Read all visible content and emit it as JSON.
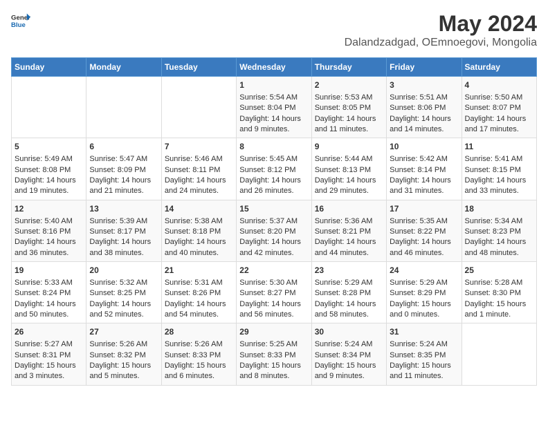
{
  "header": {
    "logo_line1": "General",
    "logo_line2": "Blue",
    "title": "May 2024",
    "subtitle": "Dalandzadgad, OEmnoegovi, Mongolia"
  },
  "weekdays": [
    "Sunday",
    "Monday",
    "Tuesday",
    "Wednesday",
    "Thursday",
    "Friday",
    "Saturday"
  ],
  "weeks": [
    [
      {
        "day": "",
        "content": ""
      },
      {
        "day": "",
        "content": ""
      },
      {
        "day": "",
        "content": ""
      },
      {
        "day": "1",
        "content": "Sunrise: 5:54 AM\nSunset: 8:04 PM\nDaylight: 14 hours\nand 9 minutes."
      },
      {
        "day": "2",
        "content": "Sunrise: 5:53 AM\nSunset: 8:05 PM\nDaylight: 14 hours\nand 11 minutes."
      },
      {
        "day": "3",
        "content": "Sunrise: 5:51 AM\nSunset: 8:06 PM\nDaylight: 14 hours\nand 14 minutes."
      },
      {
        "day": "4",
        "content": "Sunrise: 5:50 AM\nSunset: 8:07 PM\nDaylight: 14 hours\nand 17 minutes."
      }
    ],
    [
      {
        "day": "5",
        "content": "Sunrise: 5:49 AM\nSunset: 8:08 PM\nDaylight: 14 hours\nand 19 minutes."
      },
      {
        "day": "6",
        "content": "Sunrise: 5:47 AM\nSunset: 8:09 PM\nDaylight: 14 hours\nand 21 minutes."
      },
      {
        "day": "7",
        "content": "Sunrise: 5:46 AM\nSunset: 8:11 PM\nDaylight: 14 hours\nand 24 minutes."
      },
      {
        "day": "8",
        "content": "Sunrise: 5:45 AM\nSunset: 8:12 PM\nDaylight: 14 hours\nand 26 minutes."
      },
      {
        "day": "9",
        "content": "Sunrise: 5:44 AM\nSunset: 8:13 PM\nDaylight: 14 hours\nand 29 minutes."
      },
      {
        "day": "10",
        "content": "Sunrise: 5:42 AM\nSunset: 8:14 PM\nDaylight: 14 hours\nand 31 minutes."
      },
      {
        "day": "11",
        "content": "Sunrise: 5:41 AM\nSunset: 8:15 PM\nDaylight: 14 hours\nand 33 minutes."
      }
    ],
    [
      {
        "day": "12",
        "content": "Sunrise: 5:40 AM\nSunset: 8:16 PM\nDaylight: 14 hours\nand 36 minutes."
      },
      {
        "day": "13",
        "content": "Sunrise: 5:39 AM\nSunset: 8:17 PM\nDaylight: 14 hours\nand 38 minutes."
      },
      {
        "day": "14",
        "content": "Sunrise: 5:38 AM\nSunset: 8:18 PM\nDaylight: 14 hours\nand 40 minutes."
      },
      {
        "day": "15",
        "content": "Sunrise: 5:37 AM\nSunset: 8:20 PM\nDaylight: 14 hours\nand 42 minutes."
      },
      {
        "day": "16",
        "content": "Sunrise: 5:36 AM\nSunset: 8:21 PM\nDaylight: 14 hours\nand 44 minutes."
      },
      {
        "day": "17",
        "content": "Sunrise: 5:35 AM\nSunset: 8:22 PM\nDaylight: 14 hours\nand 46 minutes."
      },
      {
        "day": "18",
        "content": "Sunrise: 5:34 AM\nSunset: 8:23 PM\nDaylight: 14 hours\nand 48 minutes."
      }
    ],
    [
      {
        "day": "19",
        "content": "Sunrise: 5:33 AM\nSunset: 8:24 PM\nDaylight: 14 hours\nand 50 minutes."
      },
      {
        "day": "20",
        "content": "Sunrise: 5:32 AM\nSunset: 8:25 PM\nDaylight: 14 hours\nand 52 minutes."
      },
      {
        "day": "21",
        "content": "Sunrise: 5:31 AM\nSunset: 8:26 PM\nDaylight: 14 hours\nand 54 minutes."
      },
      {
        "day": "22",
        "content": "Sunrise: 5:30 AM\nSunset: 8:27 PM\nDaylight: 14 hours\nand 56 minutes."
      },
      {
        "day": "23",
        "content": "Sunrise: 5:29 AM\nSunset: 8:28 PM\nDaylight: 14 hours\nand 58 minutes."
      },
      {
        "day": "24",
        "content": "Sunrise: 5:29 AM\nSunset: 8:29 PM\nDaylight: 15 hours\nand 0 minutes."
      },
      {
        "day": "25",
        "content": "Sunrise: 5:28 AM\nSunset: 8:30 PM\nDaylight: 15 hours\nand 1 minute."
      }
    ],
    [
      {
        "day": "26",
        "content": "Sunrise: 5:27 AM\nSunset: 8:31 PM\nDaylight: 15 hours\nand 3 minutes."
      },
      {
        "day": "27",
        "content": "Sunrise: 5:26 AM\nSunset: 8:32 PM\nDaylight: 15 hours\nand 5 minutes."
      },
      {
        "day": "28",
        "content": "Sunrise: 5:26 AM\nSunset: 8:33 PM\nDaylight: 15 hours\nand 6 minutes."
      },
      {
        "day": "29",
        "content": "Sunrise: 5:25 AM\nSunset: 8:33 PM\nDaylight: 15 hours\nand 8 minutes."
      },
      {
        "day": "30",
        "content": "Sunrise: 5:24 AM\nSunset: 8:34 PM\nDaylight: 15 hours\nand 9 minutes."
      },
      {
        "day": "31",
        "content": "Sunrise: 5:24 AM\nSunset: 8:35 PM\nDaylight: 15 hours\nand 11 minutes."
      },
      {
        "day": "",
        "content": ""
      }
    ]
  ]
}
